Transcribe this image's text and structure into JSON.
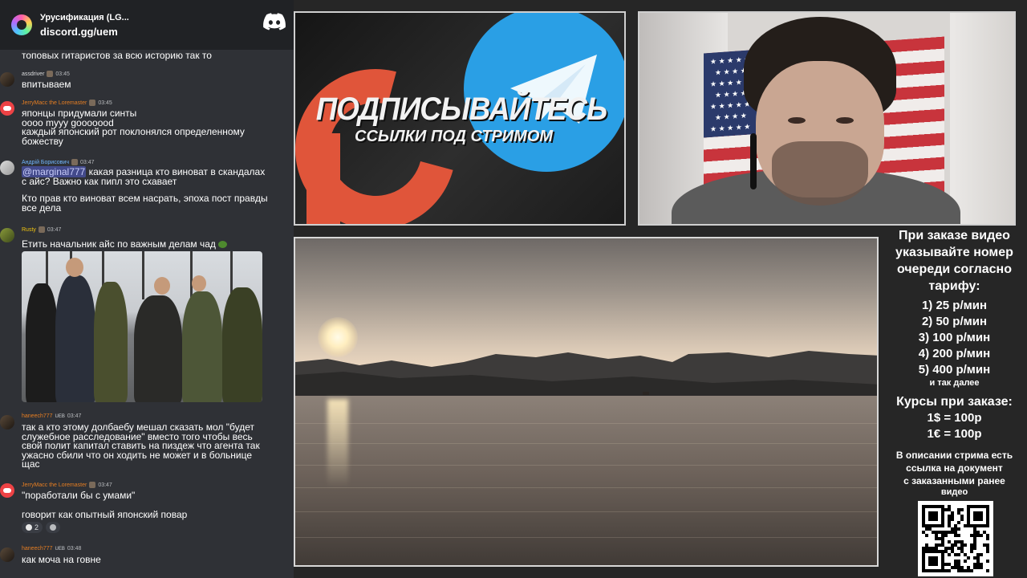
{
  "chat": {
    "header": {
      "server_name": "Урусификация (LG...",
      "invite": "discord.gg/uem",
      "logo_icon": "discord-icon"
    },
    "messages": [
      {
        "id": "m0",
        "text": "топовых гитаристов за всю историю так то"
      },
      {
        "id": "m1",
        "username": "assdriver",
        "username_color": "#dcddde",
        "time": "03:45",
        "text": "впитываем"
      },
      {
        "id": "m2",
        "username": "JerryMacc the Loremaster",
        "username_color": "#e67e22",
        "time": "03:45",
        "lines": [
          "японцы придумали синты",
          "оооо myyy gooooood",
          "каждый японский рот поклонялся определенному",
          "божеству"
        ]
      },
      {
        "id": "m3",
        "username": "Андрій Борисович",
        "username_color": "#71b7ff",
        "time": "03:47",
        "mention": "@marginal777",
        "lines": [
          "какая разница кто виноват в скандалах",
          "с айс? Важно как пипл это схавает"
        ],
        "lines2": [
          "Кто прав кто виноват всем насрать, эпоха пост правды",
          "все дела"
        ]
      },
      {
        "id": "m4",
        "username": "Rusty",
        "username_color": "#f1c40f",
        "time": "03:47",
        "text": "Етить начальник айс по важным делам чад"
      },
      {
        "id": "m5",
        "username": "haneech777",
        "username_color": "#e67e22",
        "tag": "UEB",
        "time": "03:47",
        "lines": [
          "так а кто этому долбаебу мешал сказать мол \"будет",
          "служебное расследование\" вместо того чтобы весь",
          "свой полит капитал ставить на пиздеж что агента так",
          "ужасно сбили что он ходить не может и в больнице",
          "щас"
        ]
      },
      {
        "id": "m6",
        "username": "JerryMacc the Loremaster",
        "username_color": "#e67e22",
        "time": "03:47",
        "text": "\"поработали бы с умами\"",
        "text2": "говорит как опытный японский повар",
        "reaction_count": "2"
      },
      {
        "id": "m7",
        "username": "haneech777",
        "username_color": "#e67e22",
        "tag": "UEB",
        "time": "03:48",
        "text": "как моча на говне"
      }
    ]
  },
  "promo": {
    "title": "ПОДПИСЫВАЙТЕСЬ",
    "subtitle": "ССЫЛКИ ПОД СТРИМОМ",
    "patreon_color": "#e0553a",
    "telegram_color": "#2a9fe5"
  },
  "info": {
    "order_lines": [
      "При заказе видео",
      "указывайте номер",
      "очереди согласно",
      "тарифу:"
    ],
    "tariffs": [
      "1) 25 р/мин",
      "2) 50 р/мин",
      "3) 100 р/мин",
      "4) 200 р/мин",
      "5) 400 р/мин"
    ],
    "and_so_on": "и так далее",
    "rates_title": "Курсы при заказе:",
    "rates": [
      "1$ = 100р",
      "1€ = 100р"
    ],
    "doc_lines": [
      "В описании стрима есть",
      "ссылка на документ",
      "с заказанными ранее",
      "видео"
    ],
    "qr_icon": "qr-code-icon"
  }
}
